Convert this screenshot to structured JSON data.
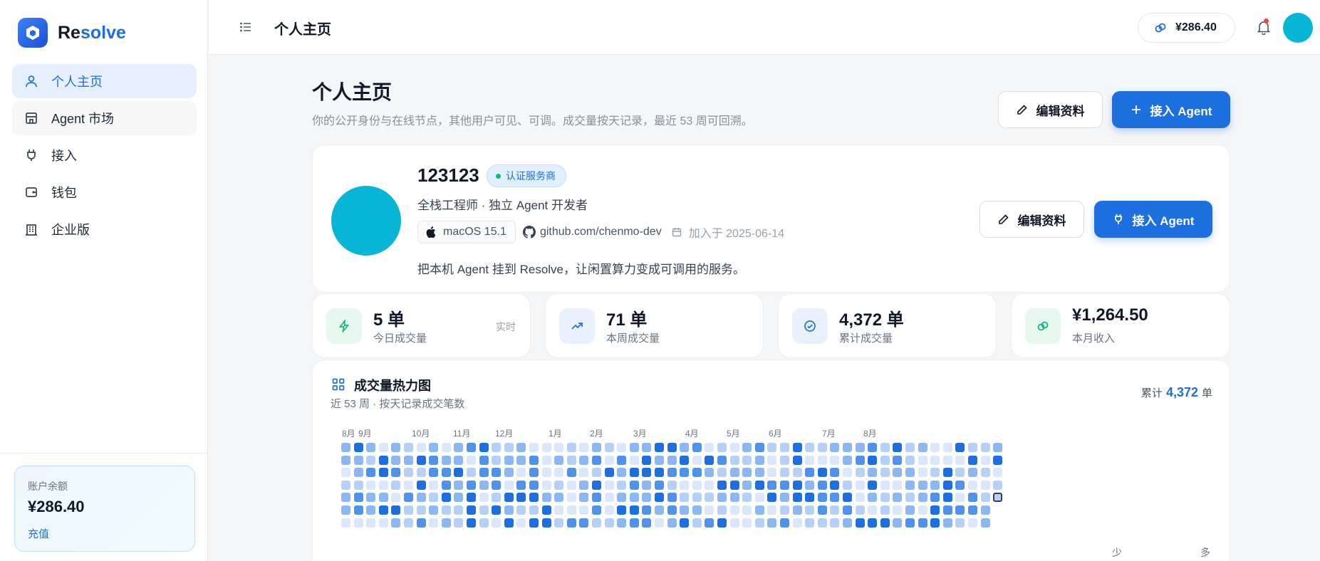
{
  "app": {
    "logo_text_a": "Re",
    "logo_text_b": "solve",
    "brand_color": "#1d6fe0"
  },
  "sidebar": {
    "items": [
      {
        "label": "个人主页",
        "icon": "user-icon",
        "active": true
      },
      {
        "label": "Agent 市场",
        "icon": "store-icon"
      },
      {
        "label": "接入",
        "icon": "plug-icon"
      },
      {
        "label": "钱包",
        "icon": "wallet-icon"
      },
      {
        "label": "企业版",
        "icon": "building-icon"
      }
    ],
    "balance": {
      "label": "账户余额",
      "value": "¥286.40",
      "action": "充值"
    }
  },
  "topbar": {
    "title": "个人主页",
    "balance": "¥286.40"
  },
  "page": {
    "title": "个人主页",
    "subtitle": "你的公开身份与在线节点，其他用户可见、可调。成交量按天记录，最近 53 周可回溯。",
    "edit_label": "编辑资料",
    "connect_label": "接入 Agent"
  },
  "profile": {
    "name": "123123",
    "badge": "认证服务商",
    "desc": "全栈工程师 · 独立 Agent 开发者",
    "os": "macOS 15.1",
    "github": "github.com/chenmo-dev",
    "joined": "加入于 2025-06-14",
    "bio": "把本机 Agent 挂到 Resolve，让闲置算力变成可调用的服务。",
    "edit_label": "编辑资料",
    "connect_label": "接入 Agent"
  },
  "stats": [
    {
      "value": "5 单",
      "label": "今日成交量",
      "tag": "实时",
      "icon": "bolt-icon",
      "color": "#10b981",
      "bg": "#e6f7ef"
    },
    {
      "value": "71 单",
      "label": "本周成交量",
      "icon": "trend-up-icon",
      "color": "#1d6fe0",
      "bg": "#e8f1fd"
    },
    {
      "value": "4,372 单",
      "label": "累计成交量",
      "icon": "check-circle-icon",
      "color": "#1d6fe0",
      "bg": "#e8f1fd"
    },
    {
      "value": "¥1,264.50",
      "label": "本月收入",
      "icon": "coins-icon",
      "color": "#10b981",
      "bg": "#e6f7ef"
    }
  ],
  "heatmap": {
    "title": "成交量热力图",
    "subtitle": "近 53 周 · 按天记录成交笔数",
    "total_prefix": "累计",
    "total_value": "4,372",
    "total_suffix": "单",
    "months": [
      "8月",
      "9月",
      "10月",
      "11月",
      "12月",
      "1月",
      "2月",
      "3月",
      "4月",
      "5月",
      "6月",
      "7月",
      "8月"
    ],
    "legend_less": "少",
    "legend_more": "多",
    "weeks": 53,
    "colors": [
      "#dbe7fb",
      "#b6d1f7",
      "#8bb7f3",
      "#4f92ec",
      "#1d6fe0"
    ]
  }
}
